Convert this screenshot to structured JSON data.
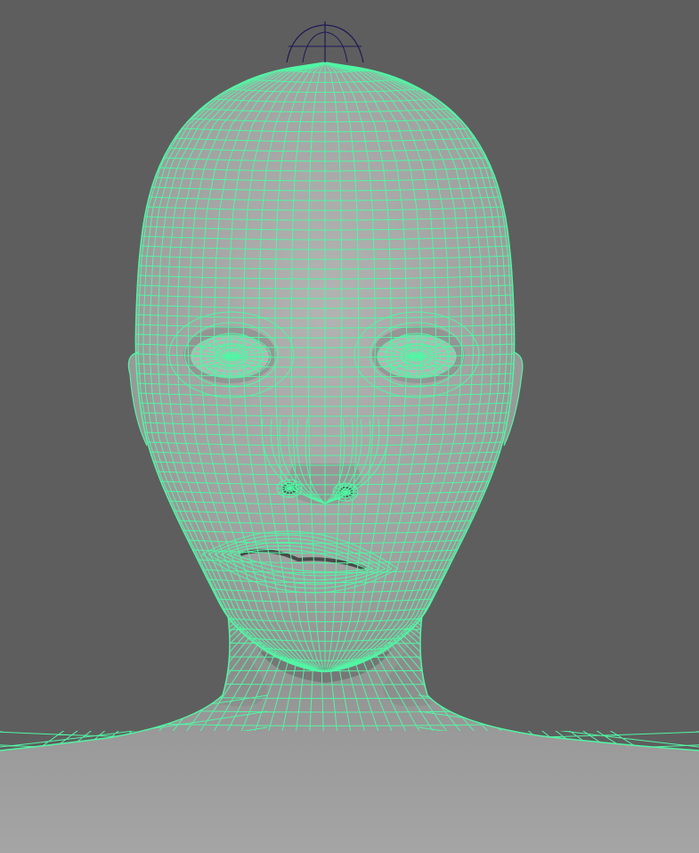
{
  "viewport": {
    "background_color": "#5e5e5e",
    "surface_color": "#a3a3a3",
    "surface_shadow_color": "#7c7c7c",
    "wireframe_color": "#52f5a4",
    "locator_color": "#1f1a55",
    "shading_mode": "wireframe-on-shaded",
    "camera_view": "front"
  },
  "objects": [
    {
      "name": "head-mesh",
      "kind": "polygon-mesh",
      "selected": true
    },
    {
      "name": "eye-left",
      "kind": "polygon-mesh",
      "selected": true
    },
    {
      "name": "eye-right",
      "kind": "polygon-mesh",
      "selected": true
    },
    {
      "name": "top-locator",
      "kind": "locator",
      "selected": false
    }
  ]
}
